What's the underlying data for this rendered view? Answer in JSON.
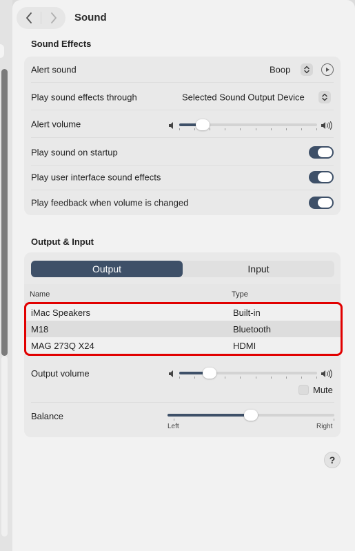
{
  "header": {
    "title": "Sound",
    "back_icon": "chevron-left-icon",
    "forward_icon": "chevron-right-icon"
  },
  "sound_effects": {
    "section_title": "Sound Effects",
    "alert_sound": {
      "label": "Alert sound",
      "value": "Boop"
    },
    "play_through": {
      "label": "Play sound effects through",
      "value": "Selected Sound Output Device"
    },
    "alert_volume": {
      "label": "Alert volume",
      "level": 0.17
    },
    "startup": {
      "label": "Play sound on startup",
      "on": true
    },
    "ui_effects": {
      "label": "Play user interface sound effects",
      "on": true
    },
    "feedback": {
      "label": "Play feedback when volume is changed",
      "on": true
    }
  },
  "output_input": {
    "section_title": "Output & Input",
    "tabs": [
      {
        "label": "Output",
        "selected": true
      },
      {
        "label": "Input",
        "selected": false
      }
    ],
    "table": {
      "columns": [
        "Name",
        "Type"
      ],
      "rows": [
        {
          "name": "iMac Speakers",
          "type": "Built-in"
        },
        {
          "name": "M18",
          "type": "Bluetooth"
        },
        {
          "name": "MAG 273Q X24",
          "type": "HDMI"
        }
      ],
      "selected_row": 1
    },
    "output_volume": {
      "label": "Output volume",
      "level": 0.22
    },
    "mute": {
      "label": "Mute",
      "checked": false
    },
    "balance": {
      "label": "Balance",
      "left_label": "Left",
      "right_label": "Right",
      "level": 0.5
    }
  },
  "help": {
    "label": "?"
  },
  "colors": {
    "accent": "#3e5068",
    "highlight_border": "#e10000"
  }
}
